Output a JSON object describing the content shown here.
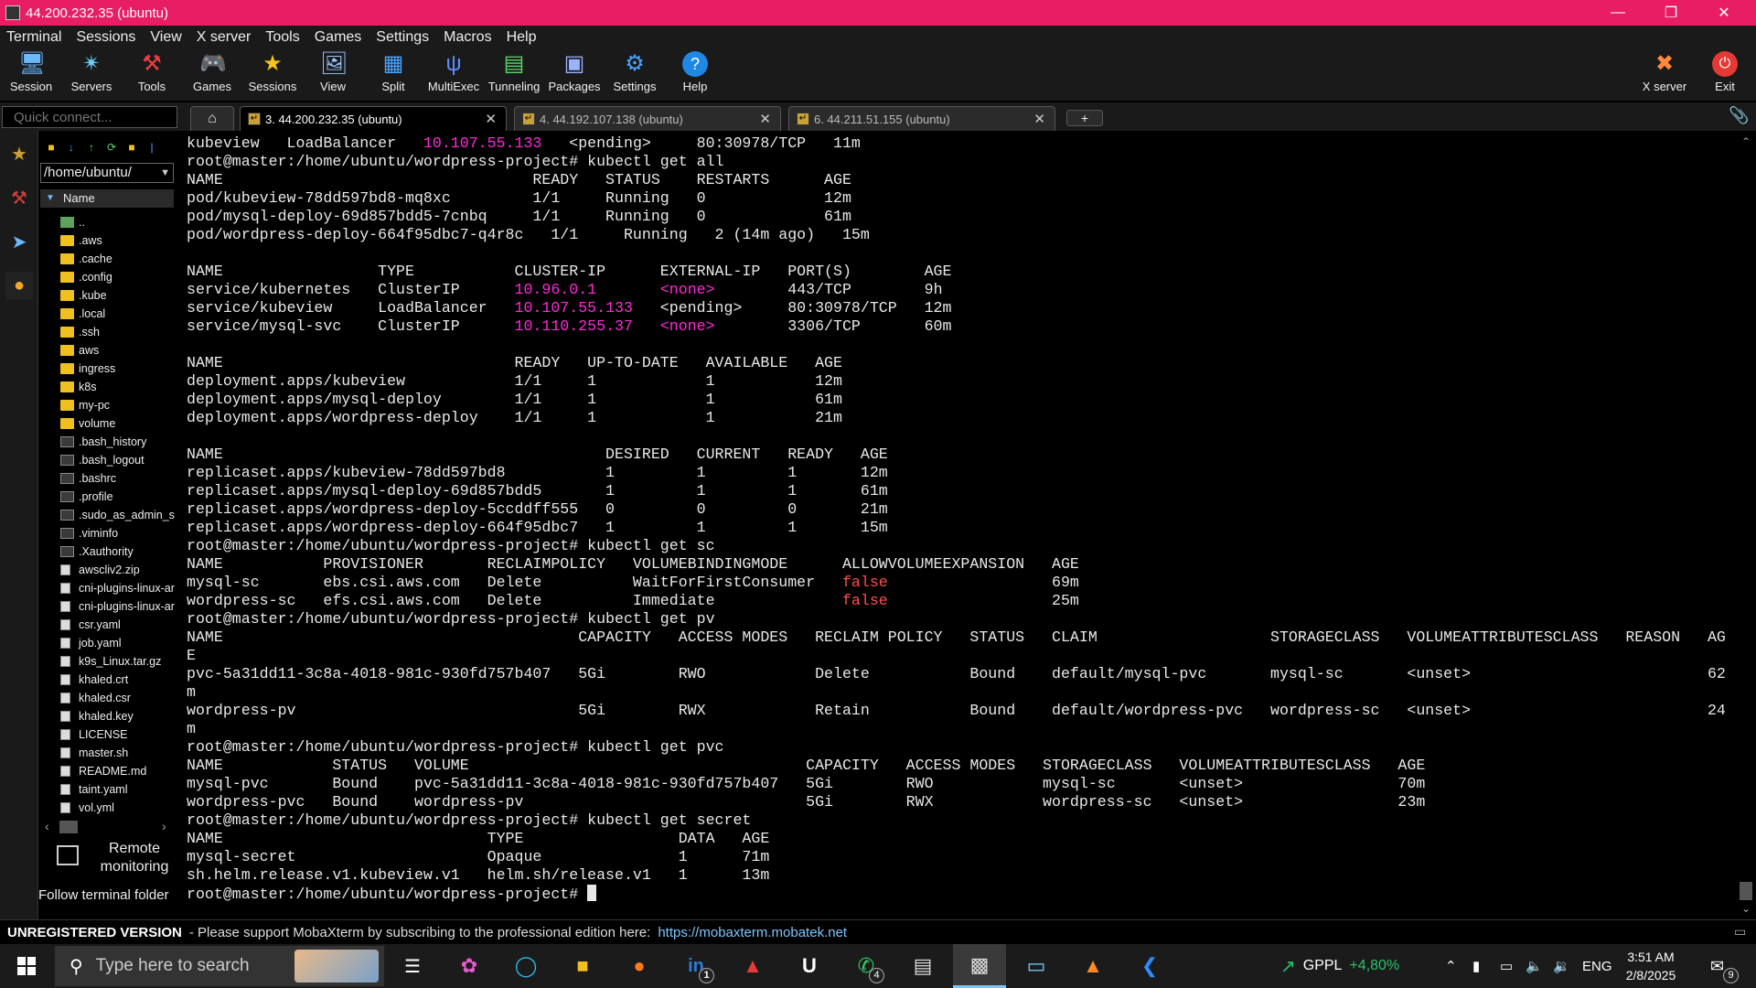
{
  "window": {
    "title": "44.200.232.35 (ubuntu)"
  },
  "menu": [
    "Terminal",
    "Sessions",
    "View",
    "X server",
    "Tools",
    "Games",
    "Settings",
    "Macros",
    "Help"
  ],
  "toolbar": {
    "session": "Session",
    "servers": "Servers",
    "tools": "Tools",
    "games": "Games",
    "sessions": "Sessions",
    "view": "View",
    "split": "Split",
    "multiexec": "MultiExec",
    "tunneling": "Tunneling",
    "packages": "Packages",
    "settings": "Settings",
    "help": "Help",
    "xserver": "X server",
    "exit": "Exit"
  },
  "quick_connect": {
    "placeholder": "Quick connect..."
  },
  "tabs": [
    {
      "label": "3. 44.200.232.35 (ubuntu)"
    },
    {
      "label": "4. 44.192.107.138 (ubuntu)"
    },
    {
      "label": "6. 44.211.51.155 (ubuntu)"
    }
  ],
  "sftp": {
    "path": "/home/ubuntu/",
    "column": "Name",
    "files": [
      "..",
      ".aws",
      ".cache",
      ".config",
      ".kube",
      ".local",
      ".ssh",
      "aws",
      "ingress",
      "k8s",
      "my-pc",
      "volume",
      ".bash_history",
      ".bash_logout",
      ".bashrc",
      ".profile",
      ".sudo_as_admin_s",
      ".viminfo",
      ".Xauthority",
      "awscliv2.zip",
      "cni-plugins-linux-ar",
      "cni-plugins-linux-ar",
      "csr.yaml",
      "job.yaml",
      "k9s_Linux.tar.gz",
      "khaled.crt",
      "khaled.csr",
      "khaled.key",
      "LICENSE",
      "master.sh",
      "README.md",
      "taint.yaml",
      "vol.yml"
    ],
    "remote_monitoring": "Remote monitoring",
    "follow_terminal": "Follow terminal folder"
  },
  "terminal": {
    "lines": [
      [
        [
          "kubeview   LoadBalancer   ",
          ""
        ],
        [
          "10.107.55.133",
          "m"
        ],
        [
          "   <pending>     80:30978/TCP   11m",
          ""
        ]
      ],
      [
        [
          "root@master:/home/ubuntu/wordpress-project# kubectl get all",
          ""
        ]
      ],
      [
        [
          "NAME                                  READY   STATUS    RESTARTS      AGE",
          ""
        ]
      ],
      [
        [
          "pod/kubeview-78dd597bd8-mq8xc         1/1     Running   0             12m",
          ""
        ]
      ],
      [
        [
          "pod/mysql-deploy-69d857bdd5-7cnbq     1/1     Running   0             61m",
          ""
        ]
      ],
      [
        [
          "pod/wordpress-deploy-664f95dbc7-q4r8c   1/1     Running   2 (14m ago)   15m",
          ""
        ]
      ],
      [
        [
          "",
          ""
        ]
      ],
      [
        [
          "NAME                 TYPE           CLUSTER-IP      EXTERNAL-IP   PORT(S)        AGE",
          ""
        ]
      ],
      [
        [
          "service/kubernetes   ClusterIP      ",
          ""
        ],
        [
          "10.96.0.1",
          "m"
        ],
        [
          "       ",
          ""
        ],
        [
          "<none>",
          "m"
        ],
        [
          "        443/TCP        9h",
          ""
        ]
      ],
      [
        [
          "service/kubeview     LoadBalancer   ",
          ""
        ],
        [
          "10.107.55.133",
          "m"
        ],
        [
          "   <pending>     80:30978/TCP   12m",
          ""
        ]
      ],
      [
        [
          "service/mysql-svc    ClusterIP      ",
          ""
        ],
        [
          "10.110.255.37",
          "m"
        ],
        [
          "   ",
          ""
        ],
        [
          "<none>",
          "m"
        ],
        [
          "        3306/TCP       60m",
          ""
        ]
      ],
      [
        [
          "",
          ""
        ]
      ],
      [
        [
          "NAME                                READY   UP-TO-DATE   AVAILABLE   AGE",
          ""
        ]
      ],
      [
        [
          "deployment.apps/kubeview            1/1     1            1           12m",
          ""
        ]
      ],
      [
        [
          "deployment.apps/mysql-deploy        1/1     1            1           61m",
          ""
        ]
      ],
      [
        [
          "deployment.apps/wordpress-deploy    1/1     1            1           21m",
          ""
        ]
      ],
      [
        [
          "",
          ""
        ]
      ],
      [
        [
          "NAME                                          DESIRED   CURRENT   READY   AGE",
          ""
        ]
      ],
      [
        [
          "replicaset.apps/kubeview-78dd597bd8           1         1         1       12m",
          ""
        ]
      ],
      [
        [
          "replicaset.apps/mysql-deploy-69d857bdd5       1         1         1       61m",
          ""
        ]
      ],
      [
        [
          "replicaset.apps/wordpress-deploy-5ccddff555   0         0         0       21m",
          ""
        ]
      ],
      [
        [
          "replicaset.apps/wordpress-deploy-664f95dbc7   1         1         1       15m",
          ""
        ]
      ],
      [
        [
          "root@master:/home/ubuntu/wordpress-project# kubectl get sc",
          ""
        ]
      ],
      [
        [
          "NAME           PROVISIONER       RECLAIMPOLICY   VOLUMEBINDINGMODE      ALLOWVOLUMEEXPANSION   AGE",
          ""
        ]
      ],
      [
        [
          "mysql-sc       ebs.csi.aws.com   Delete          WaitForFirstConsumer   ",
          ""
        ],
        [
          "false",
          "r"
        ],
        [
          "                  69m",
          ""
        ]
      ],
      [
        [
          "wordpress-sc   efs.csi.aws.com   Delete          Immediate              ",
          ""
        ],
        [
          "false",
          "r"
        ],
        [
          "                  25m",
          ""
        ]
      ],
      [
        [
          "root@master:/home/ubuntu/wordpress-project# kubectl get pv",
          ""
        ]
      ],
      [
        [
          "NAME                                       CAPACITY   ACCESS MODES   RECLAIM POLICY   STATUS   CLAIM                   STORAGECLASS   VOLUMEATTRIBUTESCLASS   REASON   AG",
          ""
        ]
      ],
      [
        [
          "E",
          ""
        ]
      ],
      [
        [
          "pvc-5a31dd11-3c8a-4018-981c-930fd757b407   5Gi        RWO            Delete           Bound    default/mysql-pvc       mysql-sc       <unset>                          62",
          ""
        ]
      ],
      [
        [
          "m",
          ""
        ]
      ],
      [
        [
          "wordpress-pv                               5Gi        RWX            Retain           Bound    default/wordpress-pvc   wordpress-sc   <unset>                          24",
          ""
        ]
      ],
      [
        [
          "m",
          ""
        ]
      ],
      [
        [
          "root@master:/home/ubuntu/wordpress-project# kubectl get pvc",
          ""
        ]
      ],
      [
        [
          "NAME            STATUS   VOLUME                                     CAPACITY   ACCESS MODES   STORAGECLASS   VOLUMEATTRIBUTESCLASS   AGE",
          ""
        ]
      ],
      [
        [
          "mysql-pvc       Bound    pvc-5a31dd11-3c8a-4018-981c-930fd757b407   5Gi        RWO            mysql-sc       <unset>                 70m",
          ""
        ]
      ],
      [
        [
          "wordpress-pvc   Bound    wordpress-pv                               5Gi        RWX            wordpress-sc   <unset>                 23m",
          ""
        ]
      ],
      [
        [
          "root@master:/home/ubuntu/wordpress-project# kubectl get secret",
          ""
        ]
      ],
      [
        [
          "NAME                             TYPE                 DATA   AGE",
          ""
        ]
      ],
      [
        [
          "mysql-secret                     Opaque               1      71m",
          ""
        ]
      ],
      [
        [
          "sh.helm.release.v1.kubeview.v1   helm.sh/release.v1   1      13m",
          ""
        ]
      ],
      [
        [
          "root@master:/home/ubuntu/wordpress-project# ",
          ""
        ]
      ]
    ]
  },
  "status": {
    "unregistered": "UNREGISTERED VERSION",
    "support": "-  Please support MobaXterm by subscribing to the professional edition here:",
    "link": "https://mobaxterm.mobatek.net"
  },
  "taskbar": {
    "search_placeholder": "Type here to search",
    "linkedin_badge": "1",
    "whatsapp_badge": "4",
    "stock_name": "GPPL",
    "stock_change": "+4,80%",
    "language": "ENG",
    "time": "3:51 AM",
    "date": "2/8/2025",
    "notifications": "9"
  },
  "colors": {
    "titlebar": "#e81d63",
    "ip_magenta": "#ff2bd6",
    "false_red": "#ff4d4d",
    "link": "#7cc5ff"
  }
}
